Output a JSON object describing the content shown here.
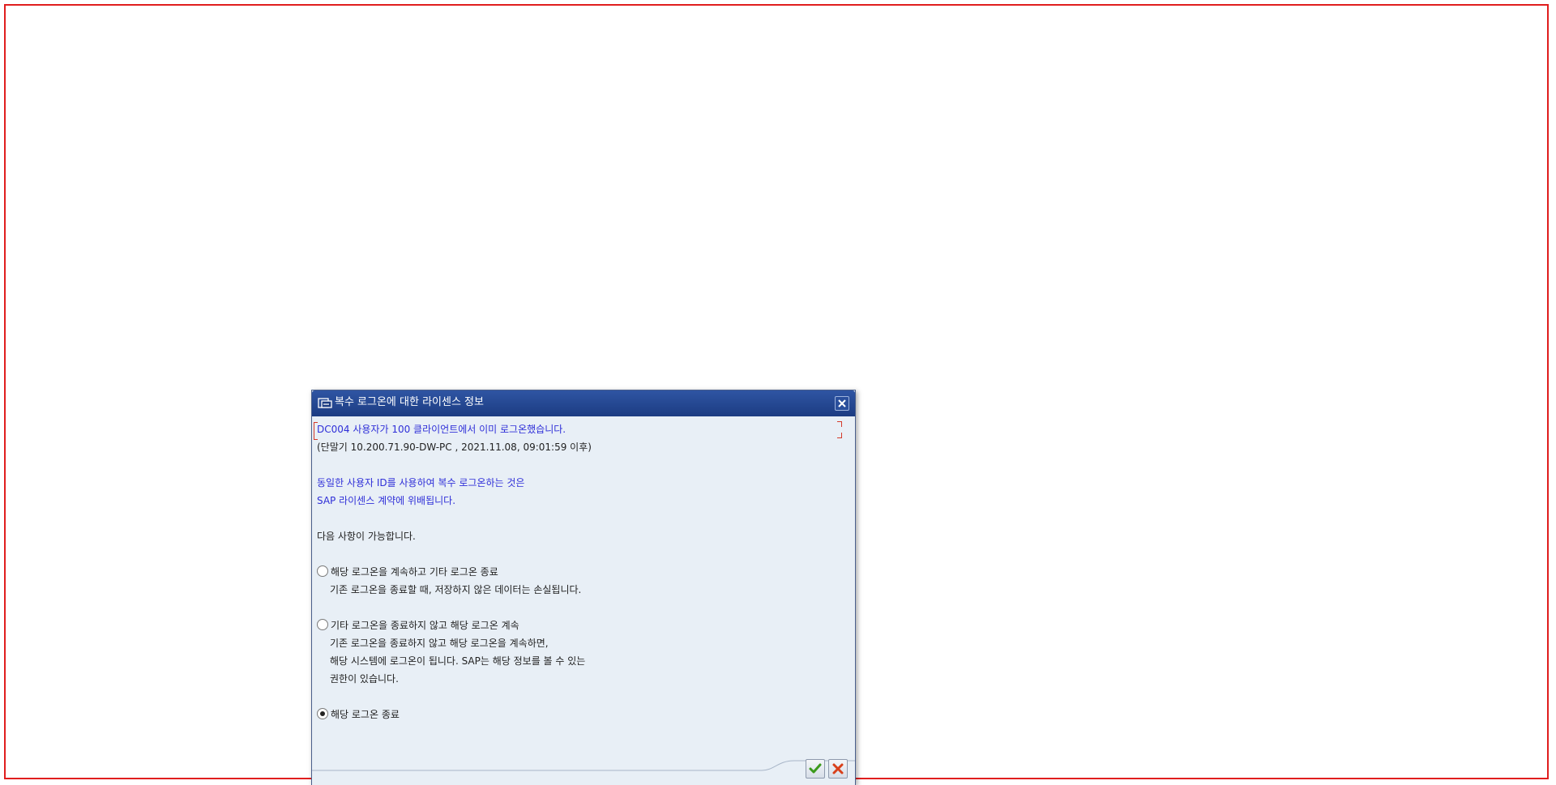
{
  "dialog": {
    "title": "복수 로그온에 대한 라이센스 정보",
    "close_label": "닫기"
  },
  "message": {
    "line1": "DC004 사용자가 100 클라이언트에서 이미 로그온했습니다.",
    "line2": "(단말기 10.200.71.90-DW-PC , 2021.11.08, 09:01:59 이후)",
    "line3": "동일한 사용자 ID를 사용하여 복수 로그온하는 것은",
    "line4": "SAP 라이센스 계약에 위배됩니다.",
    "line5": "다음 사항이 가능합니다."
  },
  "options": [
    {
      "label": "해당 로그온을 계속하고 기타 로그온 종료",
      "desc": [
        "기존 로그온을 종료할 때, 저장하지 않은 데이터는 손실됩니다."
      ],
      "checked": false
    },
    {
      "label": "기타 로그온을 종료하지 않고 해당 로그온 계속",
      "desc": [
        "기존 로그온을 종료하지 않고 해당 로그온을 계속하면,",
        "해당 시스템에 로그온이 됩니다. SAP는 해당 정보를 볼 수 있는",
        "권한이 있습니다."
      ],
      "checked": false
    },
    {
      "label": "해당 로그온 종료",
      "desc": [],
      "checked": true
    }
  ],
  "buttons": {
    "confirm_icon": "checkmark-icon",
    "cancel_icon": "cancel-x-icon"
  },
  "colors": {
    "titlebar": "#1c3c82",
    "dialog_bg": "#e8eff6",
    "message_blue": "#2f2fd8",
    "frame_red": "#e01e1e"
  }
}
